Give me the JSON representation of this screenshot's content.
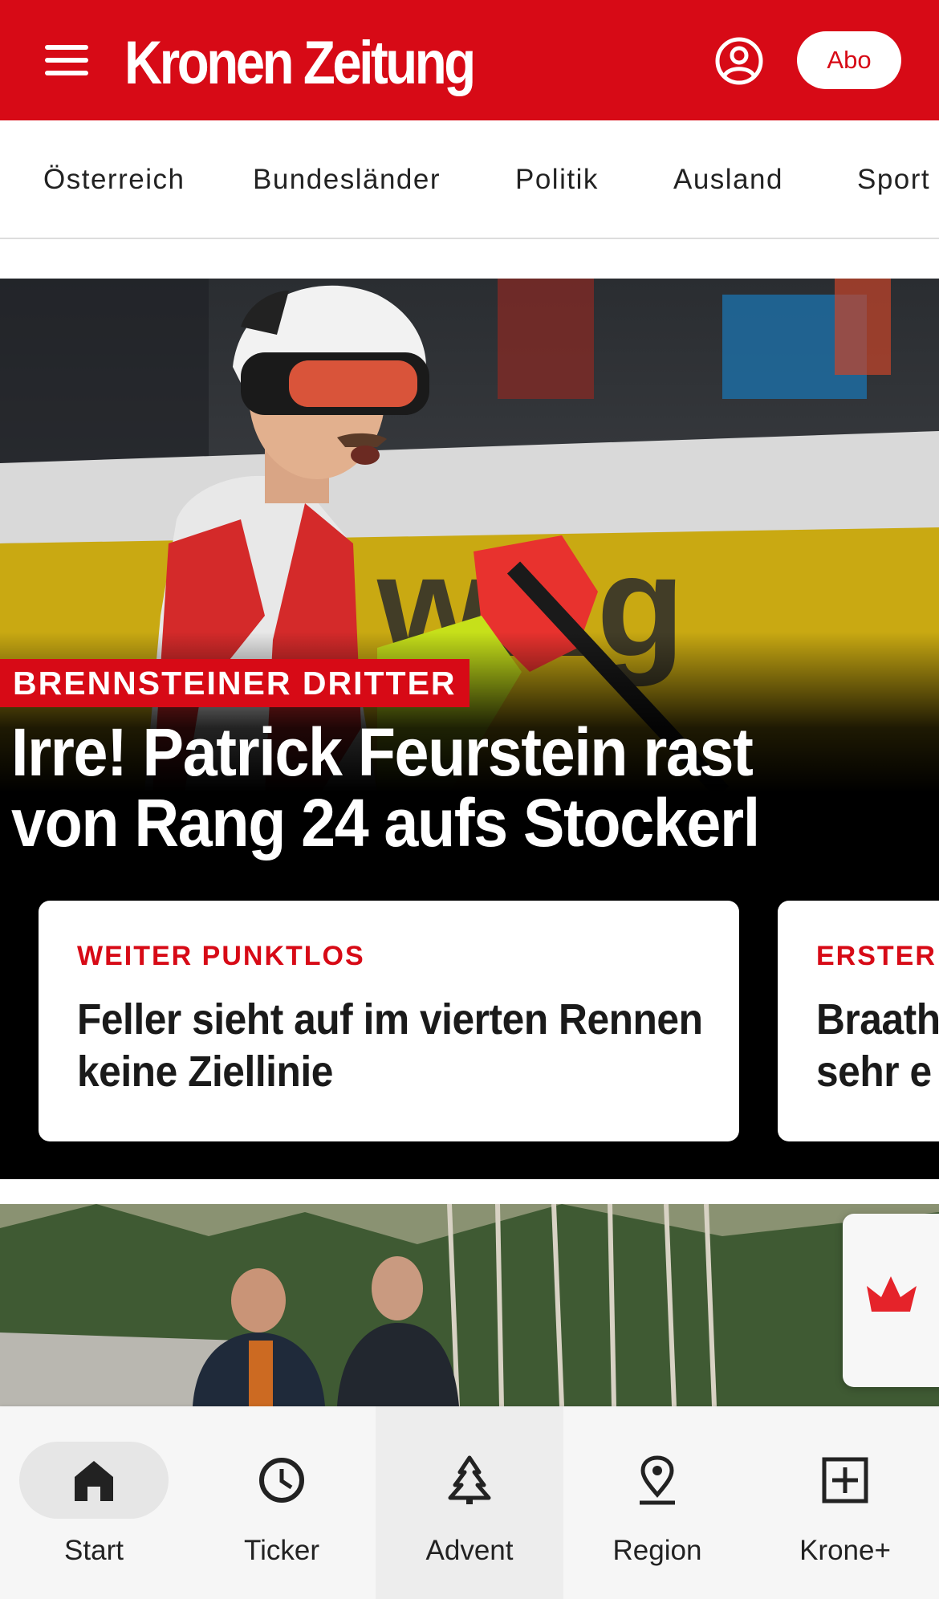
{
  "header": {
    "logo_text": "Kronen Zeitung",
    "abo_label": "Abo",
    "brand_color": "#d70a16",
    "menu_icon": "hamburger-menu-icon",
    "user_icon": "user-account-icon"
  },
  "categories": [
    "Österreich",
    "Bundesländer",
    "Politik",
    "Ausland",
    "Sport"
  ],
  "hero": {
    "kicker": "BRENNSTEINER DRITTER",
    "headline": "Irre! Patrick Feurstein rast von Rang 24 aufs Stockerl",
    "cards": [
      {
        "kicker": "WEITER PUNKTLOS",
        "title": "Feller sieht auf im vierten Rennen keine Ziellinie"
      },
      {
        "kicker": "ERSTER",
        "title": "Braath sehr e"
      }
    ]
  },
  "floating_button": {
    "icon": "krone-crown-icon"
  },
  "bottom_nav": {
    "items": [
      {
        "label": "Start",
        "icon": "home-icon",
        "active": true
      },
      {
        "label": "Ticker",
        "icon": "clock-icon"
      },
      {
        "label": "Advent",
        "icon": "christmas-tree-icon"
      },
      {
        "label": "Region",
        "icon": "location-pin-icon"
      },
      {
        "label": "Krone+",
        "icon": "plus-box-icon"
      }
    ]
  }
}
